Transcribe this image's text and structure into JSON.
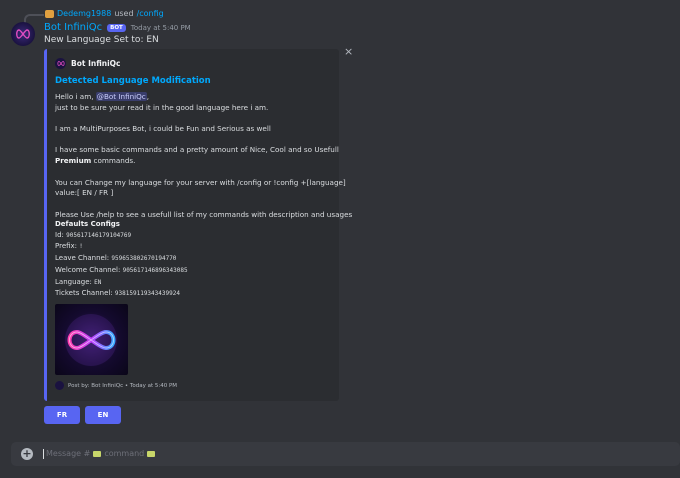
{
  "reply": {
    "user": "Dedemg1988",
    "used": "used",
    "command": "/config"
  },
  "message": {
    "author": "Bot InfiniQc",
    "bot_tag": "BOT",
    "timestamp": "Today at 5:40 PM",
    "content": "New Language Set to: EN"
  },
  "embed": {
    "author": "Bot InfiniQc",
    "title": "Detected Language Modification",
    "desc_hello": "Hello i am,",
    "desc_mention": "@Bot InfiniQc",
    "desc_hello_tail": ",",
    "desc_line2": "just to be sure your read it in the good language here i am.",
    "desc_line3": "I am a MultiPurposes Bot, i could be Fun and Serious as well",
    "desc_line4": "I have some basic commands and a pretty amount of Nice, Cool and so Usefull",
    "desc_line5_bold": "Premium",
    "desc_line5_tail": " commands.",
    "desc_line6": "You can Change my language for your server with /config or !config +[language]",
    "desc_line7": "value:[ EN / FR ]",
    "desc_line8": "Please Use /help to see a usefull list of my commands with description and usages",
    "fields_title": "Defaults Configs",
    "fields": [
      {
        "label": "Id:",
        "value": "905617146179104769"
      },
      {
        "label": "Prefix:",
        "value": "!"
      },
      {
        "label": "Leave Channel:",
        "value": "959653802670194770"
      },
      {
        "label": "Welcome Channel:",
        "value": "905617146896343085"
      },
      {
        "label": "Language:",
        "value": "EN"
      },
      {
        "label": "Tickets Channel:",
        "value": "938159119343439924"
      }
    ],
    "footer": "Post by: Bot InfiniQc • Today at 5:40 PM",
    "close_glyph": "×"
  },
  "buttons": {
    "fr": "FR",
    "en": "EN"
  },
  "composer": {
    "placeholder_prefix": "Message #",
    "placeholder_word": "command",
    "plus": "+"
  },
  "colors": {
    "blurple": "#5865f2",
    "link": "#00a8fc",
    "bg": "#313338",
    "embed_bg": "#2b2d31"
  }
}
